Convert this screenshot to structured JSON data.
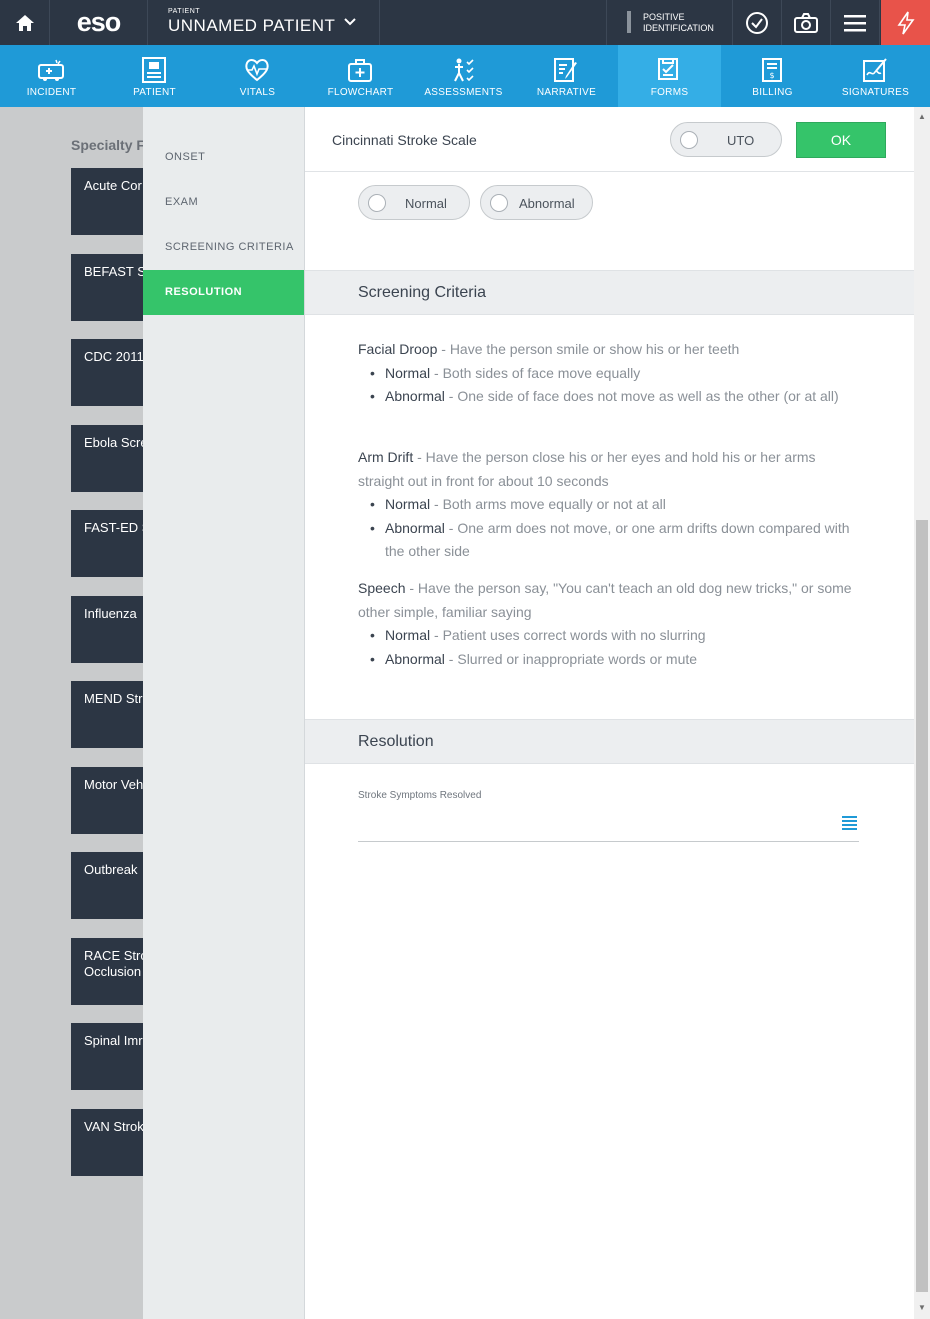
{
  "topbar": {
    "logo": "eso",
    "patient_small": "PATIENT",
    "patient_name": "UNNAMED PATIENT",
    "positive_id_line1": "POSITIVE",
    "positive_id_line2": "IDENTIFICATION"
  },
  "nav": {
    "items": [
      {
        "label": "INCIDENT",
        "icon": "ambulance-icon"
      },
      {
        "label": "PATIENT",
        "icon": "patient-chart-icon"
      },
      {
        "label": "VITALS",
        "icon": "heartbeat-icon"
      },
      {
        "label": "FLOWCHART",
        "icon": "medkit-icon"
      },
      {
        "label": "ASSESSMENTS",
        "icon": "body-check-icon"
      },
      {
        "label": "NARRATIVE",
        "icon": "pen-document-icon"
      },
      {
        "label": "FORMS",
        "icon": "forms-icon"
      },
      {
        "label": "BILLING",
        "icon": "billing-icon"
      },
      {
        "label": "SIGNATURES",
        "icon": "signature-icon"
      }
    ],
    "active": "FORMS"
  },
  "background_list": {
    "title": "Specialty F",
    "cards": [
      "Acute Cor",
      "BEFAST St",
      "CDC 2011",
      "Ebola Scre",
      "FAST-ED S",
      "Influenza",
      "MEND Str",
      "Motor Veh",
      "Outbreak",
      "RACE Stro|Occlusion",
      "Spinal Imr",
      "VAN Strok"
    ]
  },
  "side_menu": {
    "items": [
      "ONSET",
      "EXAM",
      "SCREENING CRITERIA",
      "RESOLUTION"
    ],
    "active": "RESOLUTION"
  },
  "form": {
    "title": "Cincinnati Stroke Scale",
    "uto_label": "UTO",
    "ok_label": "OK",
    "exam_options": [
      "Normal",
      "Abnormal"
    ]
  },
  "screening": {
    "header": "Screening Criteria",
    "criteria": [
      {
        "name": "Facial Droop",
        "desc": " - Have the person smile or show his or her teeth",
        "normal_label": "Normal",
        "normal_desc": " - Both sides of face move equally",
        "abnormal_label": "Abnormal",
        "abnormal_desc": " - One side of face does not move as well as the other (or at all)"
      },
      {
        "name": "Arm Drift",
        "desc": " - Have the person close his or her eyes and hold his or her arms straight out in front for about 10 seconds",
        "normal_label": "Normal",
        "normal_desc": " - Both arms move equally or not at all",
        "abnormal_label": "Abnormal",
        "abnormal_desc": " - One arm does not move, or one arm drifts down compared with the other side"
      },
      {
        "name": "Speech",
        "desc": " - Have the person say, \"You can't teach an old dog new tricks,\" or some other simple, familiar saying",
        "normal_label": "Normal",
        "normal_desc": " - Patient uses correct words with no slurring",
        "abnormal_label": "Abnormal",
        "abnormal_desc": " - Slurred or inappropriate words or mute"
      }
    ]
  },
  "resolution": {
    "header": "Resolution",
    "field_label": "Stroke Symptoms Resolved",
    "field_value": ""
  },
  "colors": {
    "topbar": "#2c3644",
    "nav": "#1f9ad7",
    "nav_active": "#34aee6",
    "accent_green": "#35c46a",
    "alert_red": "#e8534a"
  }
}
